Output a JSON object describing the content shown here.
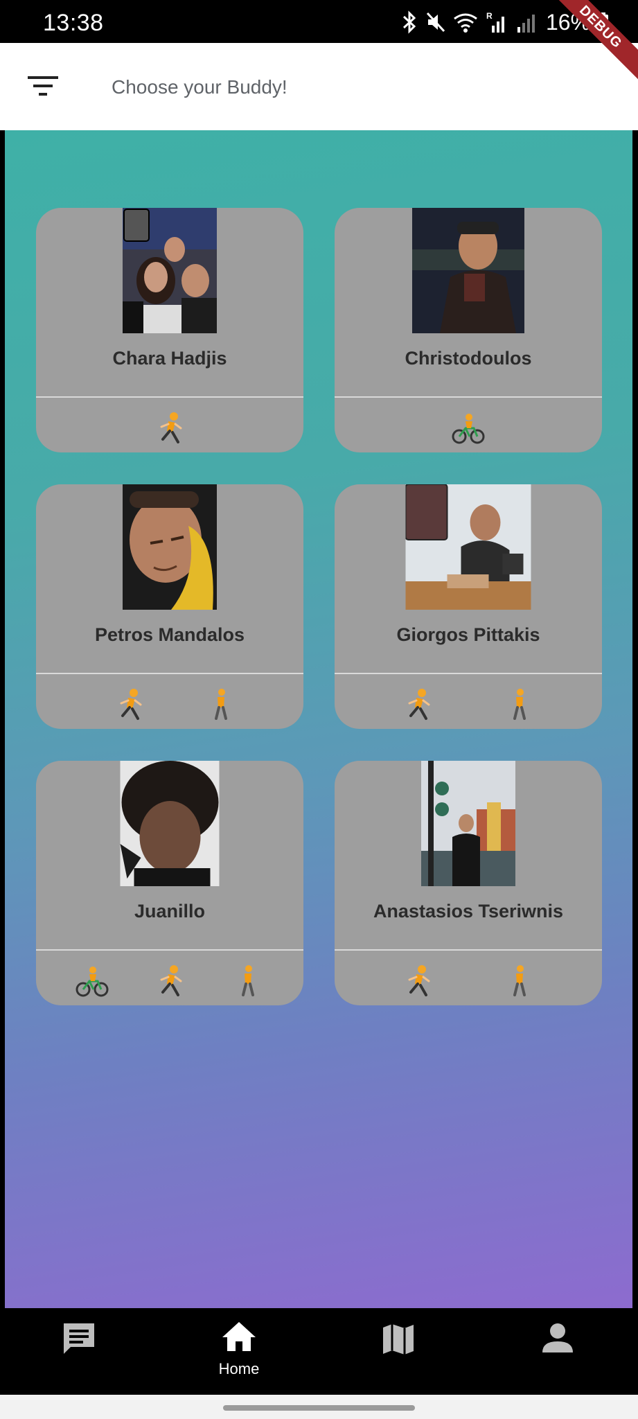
{
  "status_bar": {
    "time": "13:38",
    "battery": "16%",
    "icons": [
      "bluetooth-icon",
      "mute-icon",
      "wifi-icon",
      "signal-r-icon",
      "signal-icon",
      "battery-icon"
    ]
  },
  "debug_banner": "DEBUG",
  "app_bar": {
    "menu_icon": "filter-list-icon",
    "title": "Choose your Buddy!"
  },
  "buddies": [
    {
      "name": "Chara Hadjis",
      "activities": [
        "run"
      ]
    },
    {
      "name": "Christodoulos",
      "activities": [
        "bike"
      ]
    },
    {
      "name": "Petros Mandalos",
      "activities": [
        "run",
        "walk"
      ]
    },
    {
      "name": "Giorgos Pittakis",
      "activities": [
        "run",
        "walk"
      ]
    },
    {
      "name": "Juanillo",
      "activities": [
        "bike",
        "run",
        "walk"
      ]
    },
    {
      "name": "Anastasios Tseriwnis",
      "activities": [
        "run",
        "walk"
      ]
    }
  ],
  "bottom_nav": {
    "items": [
      {
        "icon": "chat-icon",
        "label": ""
      },
      {
        "icon": "home-icon",
        "label": "Home"
      },
      {
        "icon": "map-icon",
        "label": ""
      },
      {
        "icon": "person-icon",
        "label": ""
      }
    ]
  },
  "colors": {
    "gradient_top": "#3fb0a7",
    "gradient_bottom": "#8d6bcf",
    "card": "#9e9e9e"
  }
}
